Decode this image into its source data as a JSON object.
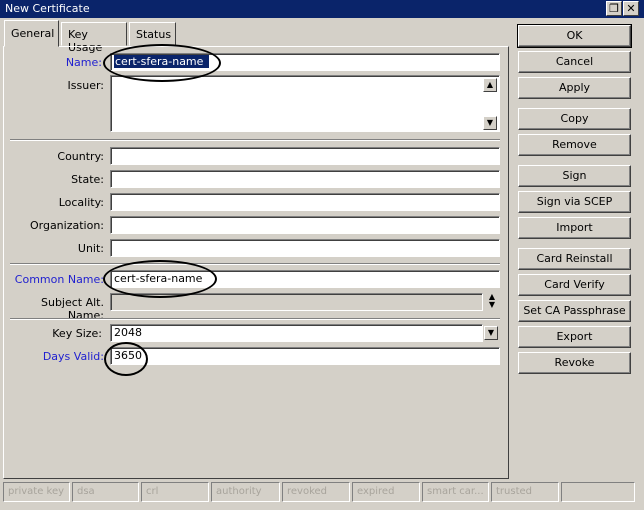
{
  "window": {
    "title": "New Certificate",
    "restore_glyph": "❐",
    "close_glyph": "✕"
  },
  "tabs": [
    {
      "label": "General",
      "active": true
    },
    {
      "label": "Key Usage",
      "active": false
    },
    {
      "label": "Status",
      "active": false
    }
  ],
  "form": {
    "name": {
      "label": "Name:",
      "value": "cert-sfera-name"
    },
    "issuer": {
      "label": "Issuer:",
      "value": ""
    },
    "country": {
      "label": "Country:",
      "value": ""
    },
    "state": {
      "label": "State:",
      "value": ""
    },
    "locality": {
      "label": "Locality:",
      "value": ""
    },
    "organization": {
      "label": "Organization:",
      "value": ""
    },
    "unit": {
      "label": "Unit:",
      "value": ""
    },
    "common_name": {
      "label": "Common Name:",
      "value": "cert-sfera-name"
    },
    "subject_alt_name": {
      "label": "Subject Alt. Name:",
      "value": ""
    },
    "key_size": {
      "label": "Key Size:",
      "value": "2048"
    },
    "days_valid": {
      "label": "Days Valid:",
      "value": "3650"
    }
  },
  "buttons": [
    "OK",
    "Cancel",
    "Apply",
    "Copy",
    "Remove",
    "Sign",
    "Sign via SCEP",
    "Import",
    "Card Reinstall",
    "Card Verify",
    "Set CA Passphrase",
    "Export",
    "Revoke"
  ],
  "status_bar": [
    "private key",
    "dsa",
    "crl",
    "authority",
    "revoked",
    "expired",
    "smart car...",
    "trusted",
    ""
  ],
  "colors": {
    "titlebar": "#0a246a",
    "window_bg": "#d4d0c8",
    "highlight_label": "#1f1fd0"
  }
}
